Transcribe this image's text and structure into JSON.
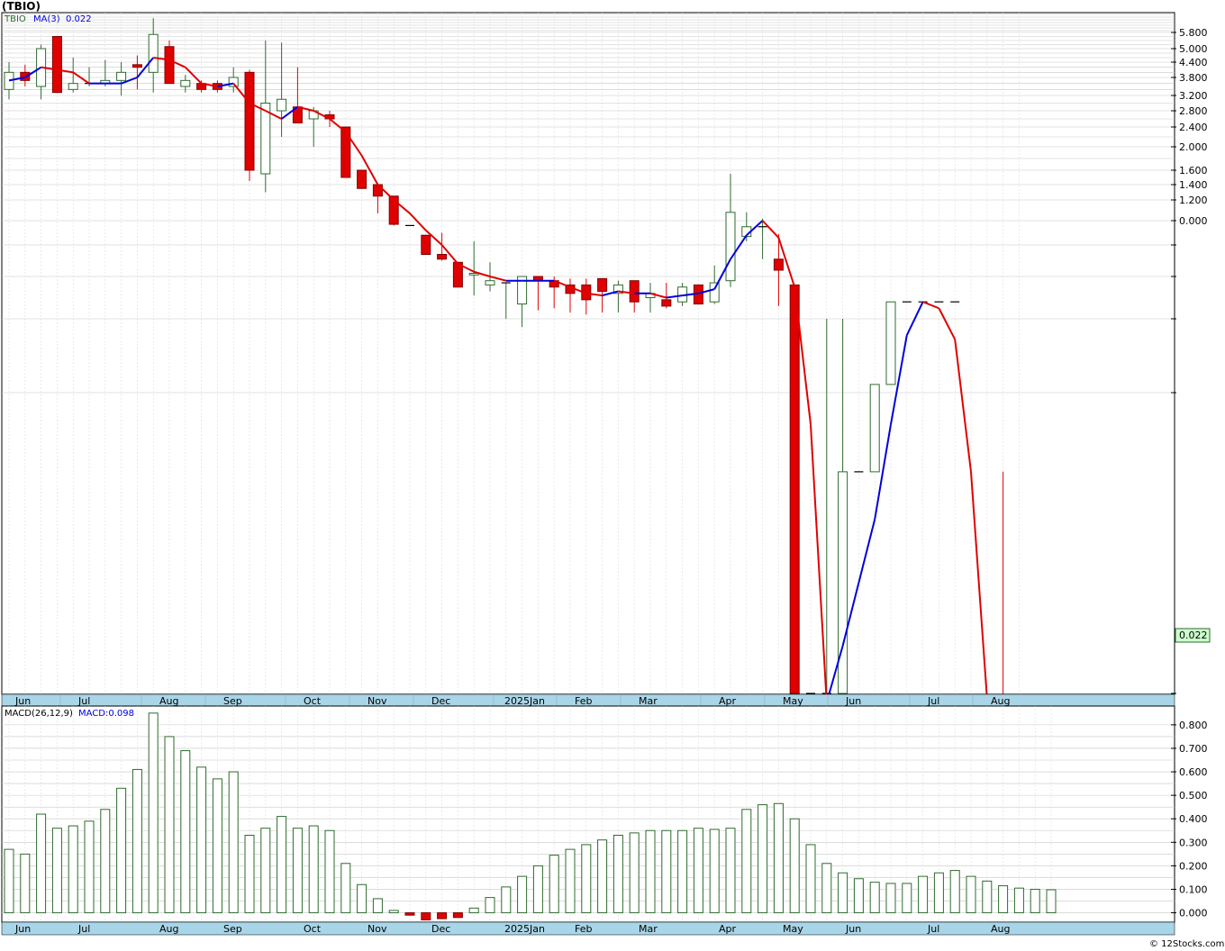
{
  "title": "(TBIO)",
  "credit": "© 12Stocks.com",
  "colors": {
    "axis_band": "#a9d5e8",
    "grid": "#c8c8c8",
    "up": "#2e6b2e",
    "down": "#e00000",
    "ma_up": "#0000dd",
    "ma_down": "#e00000",
    "macd_bar": "#2e6b2e",
    "price_tag": "#ccffcc"
  },
  "chart_data": [
    {
      "type": "candlestick",
      "legend": {
        "ticker": "TBIO",
        "ma": "MA(3)",
        "ma_value": "0.022"
      },
      "last_price_tag": "0.022",
      "price_axis_labels": [
        "5.800",
        "5.000",
        "4.400",
        "3.800",
        "3.200",
        "2.800",
        "2.400",
        "2.000",
        "1.600",
        "1.400",
        "1.200",
        "0.000"
      ],
      "price_axis_values": [
        5.8,
        5.0,
        4.4,
        3.8,
        3.2,
        2.8,
        2.4,
        2.0,
        1.6,
        1.4,
        1.2,
        1.0
      ],
      "minor_gridline_values": [
        1.0,
        0.8,
        0.6,
        0.4,
        0.22,
        0.03
      ],
      "x_labels": [
        "Jun",
        "Jul",
        "Aug",
        "Sep",
        "Oct",
        "Nov",
        "Dec",
        "2025Jan",
        "Feb",
        "Mar",
        "Apr",
        "May",
        "Jun",
        "Jul",
        "Aug"
      ],
      "candles": [
        {
          "o": 3.4,
          "h": 4.4,
          "l": 3.1,
          "c": 4.0
        },
        {
          "o": 4.0,
          "h": 4.3,
          "l": 3.5,
          "c": 3.7
        },
        {
          "o": 3.5,
          "h": 5.2,
          "l": 3.1,
          "c": 5.0
        },
        {
          "o": 5.6,
          "h": 5.6,
          "l": 3.3,
          "c": 3.3
        },
        {
          "o": 3.4,
          "h": 4.6,
          "l": 3.3,
          "c": 3.6
        },
        {
          "o": 3.6,
          "h": 4.2,
          "l": 3.5,
          "c": 3.6
        },
        {
          "o": 3.6,
          "h": 4.5,
          "l": 3.5,
          "c": 3.7
        },
        {
          "o": 3.7,
          "h": 4.4,
          "l": 3.2,
          "c": 4.0
        },
        {
          "o": 4.3,
          "h": 4.7,
          "l": 3.4,
          "c": 4.2
        },
        {
          "o": 4.0,
          "h": 6.5,
          "l": 3.3,
          "c": 5.7
        },
        {
          "o": 5.1,
          "h": 5.4,
          "l": 3.6,
          "c": 3.6
        },
        {
          "o": 3.5,
          "h": 3.9,
          "l": 3.3,
          "c": 3.7
        },
        {
          "o": 3.6,
          "h": 3.7,
          "l": 3.3,
          "c": 3.4
        },
        {
          "o": 3.6,
          "h": 3.7,
          "l": 3.3,
          "c": 3.4
        },
        {
          "o": 3.5,
          "h": 4.2,
          "l": 3.3,
          "c": 3.8
        },
        {
          "o": 4.0,
          "h": 4.1,
          "l": 1.45,
          "c": 1.6
        },
        {
          "o": 1.55,
          "h": 5.4,
          "l": 1.3,
          "c": 3.0
        },
        {
          "o": 2.8,
          "h": 5.3,
          "l": 2.2,
          "c": 3.1
        },
        {
          "o": 2.9,
          "h": 4.2,
          "l": 2.5,
          "c": 2.5
        },
        {
          "o": 2.6,
          "h": 2.9,
          "l": 2.0,
          "c": 2.8
        },
        {
          "o": 2.7,
          "h": 2.8,
          "l": 2.4,
          "c": 2.6
        },
        {
          "o": 2.4,
          "h": 2.4,
          "l": 1.5,
          "c": 1.5
        },
        {
          "o": 1.6,
          "h": 1.6,
          "l": 1.35,
          "c": 1.35
        },
        {
          "o": 1.4,
          "h": 1.4,
          "l": 1.07,
          "c": 1.25
        },
        {
          "o": 1.25,
          "h": 1.25,
          "l": 0.96,
          "c": 0.97
        },
        {
          "o": 0.96,
          "h": 0.96,
          "l": 0.96,
          "c": 0.96
        },
        {
          "o": 0.88,
          "h": 0.88,
          "l": 0.74,
          "c": 0.74
        },
        {
          "o": 0.74,
          "h": 0.9,
          "l": 0.7,
          "c": 0.71
        },
        {
          "o": 0.69,
          "h": 0.69,
          "l": 0.55,
          "c": 0.55
        },
        {
          "o": 0.61,
          "h": 0.83,
          "l": 0.51,
          "c": 0.62
        },
        {
          "o": 0.56,
          "h": 0.69,
          "l": 0.53,
          "c": 0.58
        },
        {
          "o": 0.57,
          "h": 0.57,
          "l": 0.4,
          "c": 0.57
        },
        {
          "o": 0.47,
          "h": 0.6,
          "l": 0.38,
          "c": 0.6
        },
        {
          "o": 0.6,
          "h": 0.6,
          "l": 0.44,
          "c": 0.58
        },
        {
          "o": 0.58,
          "h": 0.6,
          "l": 0.45,
          "c": 0.55
        },
        {
          "o": 0.56,
          "h": 0.59,
          "l": 0.43,
          "c": 0.52
        },
        {
          "o": 0.56,
          "h": 0.59,
          "l": 0.42,
          "c": 0.49
        },
        {
          "o": 0.59,
          "h": 0.59,
          "l": 0.43,
          "c": 0.53
        },
        {
          "o": 0.52,
          "h": 0.58,
          "l": 0.43,
          "c": 0.56
        },
        {
          "o": 0.58,
          "h": 0.58,
          "l": 0.43,
          "c": 0.48
        },
        {
          "o": 0.5,
          "h": 0.57,
          "l": 0.43,
          "c": 0.52
        },
        {
          "o": 0.49,
          "h": 0.57,
          "l": 0.45,
          "c": 0.46
        },
        {
          "o": 0.48,
          "h": 0.57,
          "l": 0.46,
          "c": 0.55
        },
        {
          "o": 0.56,
          "h": 0.56,
          "l": 0.47,
          "c": 0.47
        },
        {
          "o": 0.48,
          "h": 0.67,
          "l": 0.47,
          "c": 0.57
        },
        {
          "o": 0.58,
          "h": 1.55,
          "l": 0.55,
          "c": 1.08
        },
        {
          "o": 0.87,
          "h": 1.08,
          "l": 0.83,
          "c": 0.95
        },
        {
          "o": 0.95,
          "h": 1.02,
          "l": 0.71,
          "c": 0.95
        },
        {
          "o": 0.71,
          "h": 0.89,
          "l": 0.46,
          "c": 0.64
        },
        {
          "o": 0.56,
          "h": 0.56,
          "l": 0.03,
          "c": 0.03
        },
        {
          "o": 0.03,
          "h": 0.03,
          "l": 0.03,
          "c": 0.03
        },
        {
          "o": 0.03,
          "h": 0.4,
          "l": 0.03,
          "c": 0.03
        },
        {
          "o": 0.03,
          "h": 0.4,
          "l": 0.03,
          "c": 0.17
        },
        {
          "o": 0.17,
          "h": 0.17,
          "l": 0.17,
          "c": 0.17
        },
        {
          "o": 0.17,
          "h": 0.17,
          "l": 0.17,
          "c": 0.24
        },
        {
          "o": 0.24,
          "h": 0.48,
          "l": 0.24,
          "c": 0.48
        },
        {
          "o": 0.48,
          "h": 0.48,
          "l": 0.48,
          "c": 0.48
        },
        {
          "o": 0.48,
          "h": 0.48,
          "l": 0.48,
          "c": 0.48
        },
        {
          "o": 0.48,
          "h": 0.48,
          "l": 0.48,
          "c": 0.48
        },
        {
          "o": 0.48,
          "h": 0.48,
          "l": 0.48,
          "c": 0.48
        },
        {
          "o": 0.022,
          "h": 0.022,
          "l": 0.022,
          "c": 0.022
        },
        {
          "o": 0.016,
          "h": 0.022,
          "l": 0.016,
          "c": 0.022
        },
        {
          "o": 0.022,
          "h": 0.17,
          "l": 0.022,
          "c": 0.02
        },
        {
          "o": 0.022,
          "h": 0.022,
          "l": 0.022,
          "c": 0.022
        }
      ],
      "ma": [
        3.7,
        3.8,
        4.2,
        4.1,
        4.0,
        3.6,
        3.6,
        3.6,
        3.8,
        4.6,
        4.5,
        4.2,
        3.6,
        3.5,
        3.6,
        3.0,
        2.8,
        2.6,
        2.9,
        2.8,
        2.6,
        2.3,
        1.85,
        1.4,
        1.2,
        1.07,
        0.92,
        0.8,
        0.68,
        0.63,
        0.6,
        0.58,
        0.58,
        0.58,
        0.58,
        0.55,
        0.52,
        0.51,
        0.53,
        0.52,
        0.52,
        0.5,
        0.51,
        0.52,
        0.54,
        0.71,
        0.88,
        1.0,
        0.86,
        0.55,
        0.2,
        0.015,
        0.06,
        0.1,
        0.14,
        0.2,
        0.36,
        0.48,
        0.45,
        0.35,
        0.17,
        0.022,
        0.021,
        0.021,
        0.021
      ]
    },
    {
      "type": "bar",
      "legend": {
        "name": "MACD(26,12,9)",
        "value_label": "MACD:0.098"
      },
      "y_axis_labels": [
        "0.800",
        "0.700",
        "0.600",
        "0.500",
        "0.400",
        "0.300",
        "0.200",
        "0.100",
        "0.000"
      ],
      "ylim": [
        -0.04,
        0.88
      ],
      "values": [
        0.27,
        0.25,
        0.42,
        0.36,
        0.37,
        0.39,
        0.44,
        0.53,
        0.61,
        0.85,
        0.75,
        0.69,
        0.62,
        0.57,
        0.6,
        0.33,
        0.36,
        0.41,
        0.36,
        0.37,
        0.35,
        0.21,
        0.12,
        0.06,
        0.01,
        -0.01,
        -0.03,
        -0.025,
        -0.02,
        0.02,
        0.065,
        0.11,
        0.155,
        0.2,
        0.245,
        0.27,
        0.29,
        0.31,
        0.33,
        0.34,
        0.35,
        0.35,
        0.35,
        0.36,
        0.355,
        0.36,
        0.44,
        0.46,
        0.465,
        0.4,
        0.29,
        0.21,
        0.17,
        0.145,
        0.13,
        0.125,
        0.125,
        0.155,
        0.17,
        0.18,
        0.155,
        0.135,
        0.115,
        0.105,
        0.1,
        0.098
      ],
      "x_labels": [
        "Jun",
        "Jul",
        "Aug",
        "Sep",
        "Oct",
        "Nov",
        "Dec",
        "2025Jan",
        "Feb",
        "Mar",
        "Apr",
        "May",
        "Jun",
        "Jul",
        "Aug"
      ]
    }
  ]
}
